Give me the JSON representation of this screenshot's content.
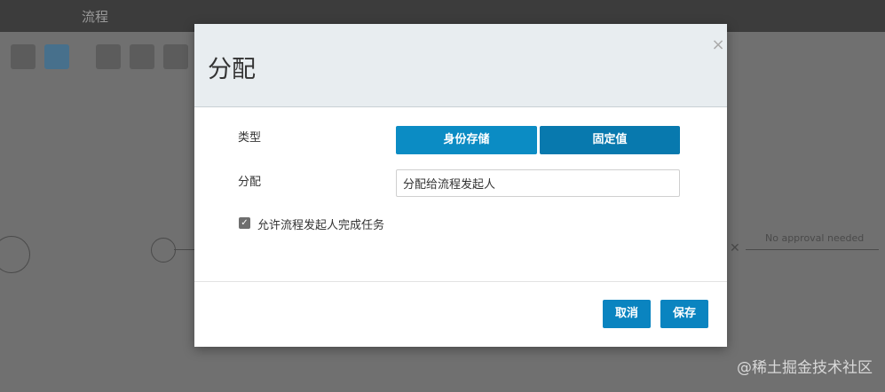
{
  "background": {
    "nav_tabs": [
      "流程",
      "",
      "",
      "",
      ""
    ],
    "canvas_labels": [
      "No approval needed"
    ]
  },
  "modal": {
    "title": "分配",
    "type_label": "类型",
    "type_options": [
      "身份存储",
      "固定值"
    ],
    "assign_label": "分配",
    "assign_value": "分配给流程发起人",
    "checkbox_checked": true,
    "checkbox_label": "允许流程发起人完成任务",
    "cancel_label": "取消",
    "save_label": "保存",
    "accent_color": "#0b8cc4"
  },
  "watermark": "@稀土掘金技术社区"
}
